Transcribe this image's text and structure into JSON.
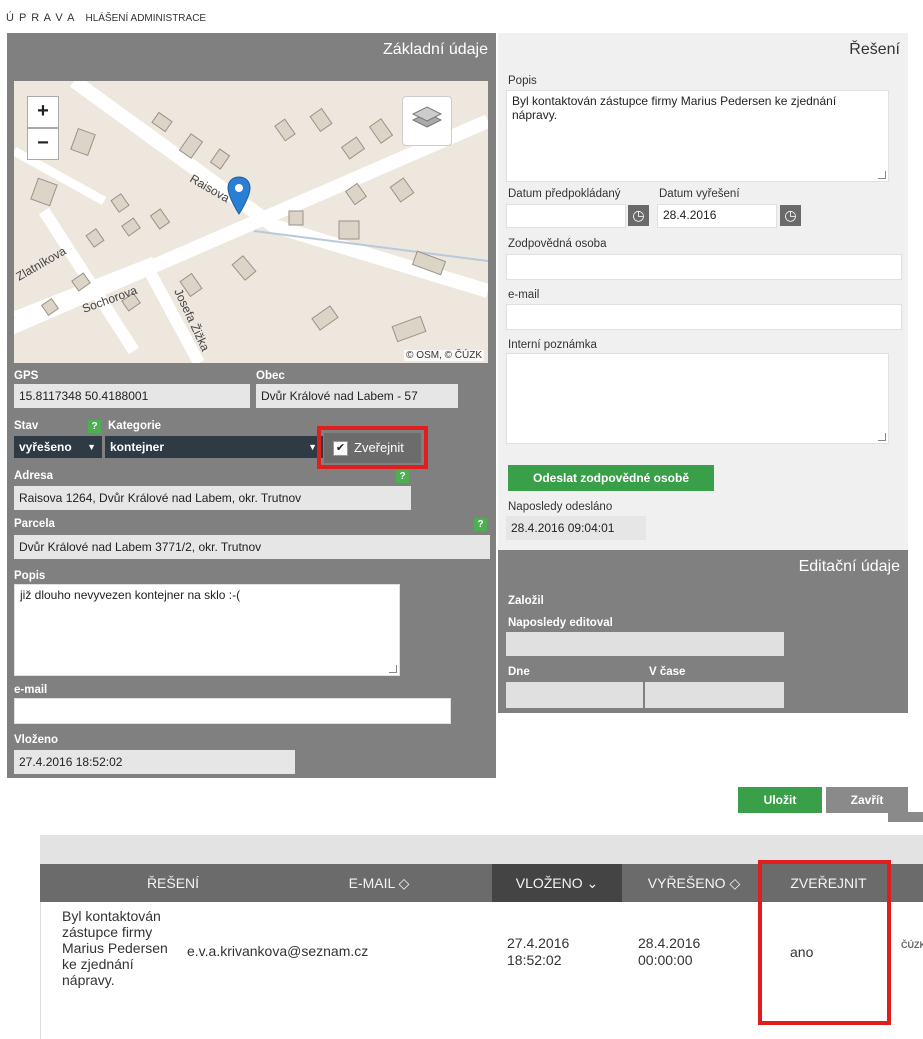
{
  "breadcrumb": {
    "part1": "Ú P R A V A",
    "part2": "HLÁŠENÍ ADMINISTRACE"
  },
  "basic": {
    "title": "Základní údaje",
    "map": {
      "attribution": "© OSM, © ČÚZK",
      "streets": [
        "Raisova",
        "Zlatníkova",
        "Sochorova",
        "Josefa Žižka"
      ],
      "zoom_in": "+",
      "zoom_out": "−"
    },
    "gps_label": "GPS",
    "gps_value": "15.8117348 50.4188001",
    "obec_label": "Obec",
    "obec_value": "Dvůr Králové nad Labem - 57",
    "stav_label": "Stav",
    "stav_value": "vyřešeno",
    "kategorie_label": "Kategorie",
    "kategorie_value": "kontejner",
    "help": "?",
    "publish_label": "Zveřejnit",
    "publish_checked": true,
    "adresa_label": "Adresa",
    "adresa_value": "Raisova 1264, Dvůr Králové nad Labem, okr. Trutnov",
    "parcela_label": "Parcela",
    "parcela_value": "Dvůr Králové nad Labem 3771/2, okr. Trutnov",
    "popis_label": "Popis",
    "popis_value": "již dlouho nevyvezen kontejner na sklo  :-(",
    "email_label": "e-mail",
    "email_value": "",
    "vlozeno_label": "Vloženo",
    "vlozeno_value": "27.4.2016 18:52:02"
  },
  "solution": {
    "title": "Řešení",
    "popis_label": "Popis",
    "popis_value": "Byl kontaktován zástupce firmy Marius Pedersen ke zjednání nápravy.",
    "date_planned_label": "Datum předpokládaný",
    "date_planned_value": "",
    "date_solved_label": "Datum vyřešení",
    "date_solved_value": "28.4.2016",
    "responsible_label": "Zodpovědná osoba",
    "responsible_value": "",
    "email_label": "e-mail",
    "email_value": "",
    "note_label": "Interní poznámka",
    "note_value": "",
    "send_button": "Odeslat zodpovědné osobě",
    "last_sent_label": "Naposledy odesláno",
    "last_sent_value": "28.4.2016 09:04:01"
  },
  "edit": {
    "title": "Editační údaje",
    "founded_label": "Založil",
    "last_edited_label": "Naposledy editoval",
    "day_label": "Dne",
    "time_label": "V čase"
  },
  "actions": {
    "save": "Uložit",
    "close": "Zavřít"
  },
  "table": {
    "headers": {
      "solution": "ŘEŠENÍ",
      "email": "E-MAIL ◇",
      "inserted": "VLOŽENO ⌄",
      "solved": "VYŘEŠENO ◇",
      "publish": "ZVEŘEJNIT"
    },
    "row": {
      "solution": "Byl kontaktován zástupce firmy Marius Pedersen ke zjednání nápravy.",
      "email": "e.v.a.krivankova@seznam.cz",
      "inserted": "27.4.2016 18:52:02",
      "solved": "28.4.2016 00:00:00",
      "publish": "ano",
      "logo": "ČÚZK"
    }
  },
  "colors": {
    "panel_dark": "#808080",
    "panel_light": "#f0f0f0",
    "accent_green": "#39a049",
    "highlight_red": "#e01e1e",
    "select_bg": "#2e3a44"
  }
}
